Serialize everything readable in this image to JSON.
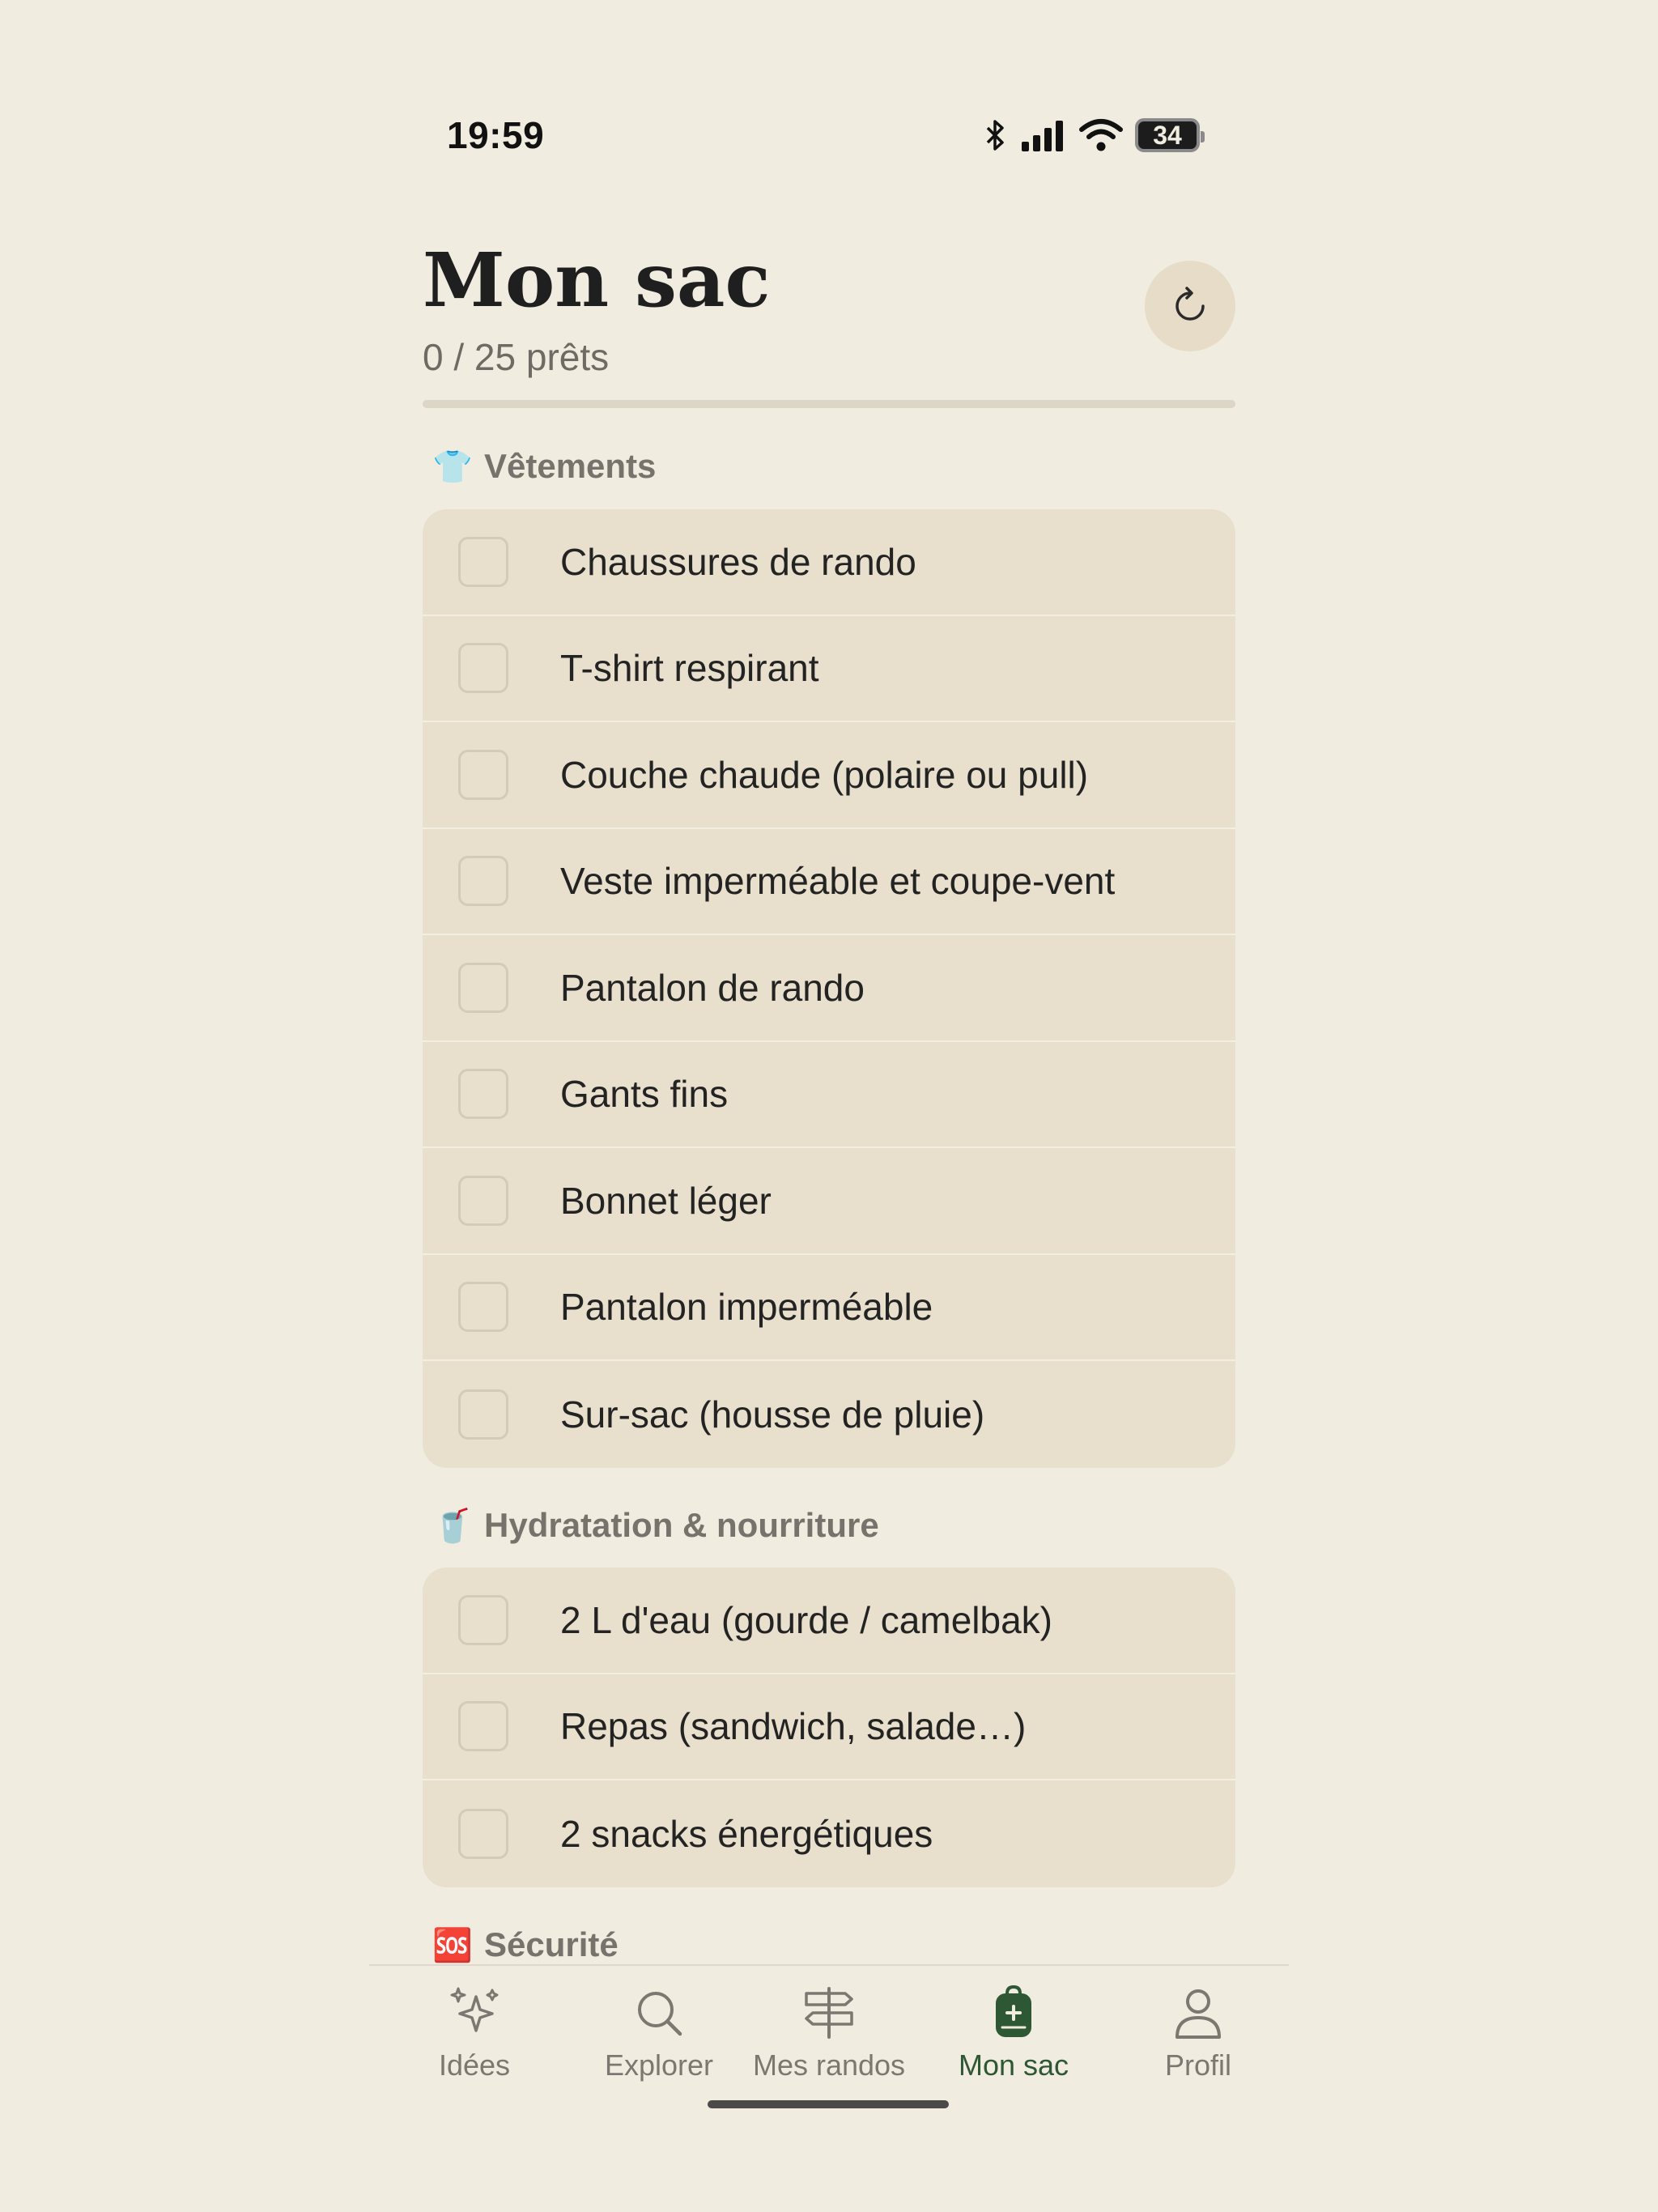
{
  "status_bar": {
    "time": "19:59",
    "battery": "34"
  },
  "header": {
    "title": "Mon sac",
    "progress_text": "0 / 25 prêts",
    "progress_fraction": 0,
    "reset_icon": "refresh-icon"
  },
  "sections": [
    {
      "emoji": "👕",
      "title": "Vêtements",
      "items": [
        "Chaussures de rando",
        "T-shirt respirant",
        "Couche chaude (polaire ou pull)",
        "Veste imperméable et coupe-vent",
        "Pantalon de rando",
        "Gants fins",
        "Bonnet léger",
        "Pantalon imperméable",
        "Sur-sac (housse de pluie)"
      ]
    },
    {
      "emoji": "🥤",
      "title": "Hydratation & nourriture",
      "items": [
        "2 L d'eau (gourde / camelbak)",
        "Repas (sandwich, salade…)",
        "2 snacks énergétiques"
      ]
    },
    {
      "emoji": "🆘",
      "title": "Sécurité",
      "items": []
    }
  ],
  "tabs": [
    {
      "label": "Idées",
      "icon": "sparkles-icon",
      "active": false
    },
    {
      "label": "Explorer",
      "icon": "search-icon",
      "active": false
    },
    {
      "label": "Mes randos",
      "icon": "signpost-icon",
      "active": false
    },
    {
      "label": "Mon sac",
      "icon": "backpack-icon",
      "active": true
    },
    {
      "label": "Profil",
      "icon": "person-icon",
      "active": false
    }
  ],
  "colors": {
    "background": "#f1ece0",
    "card": "#e8dfcc",
    "accent": "#2e5733",
    "muted_text": "#77726b"
  }
}
